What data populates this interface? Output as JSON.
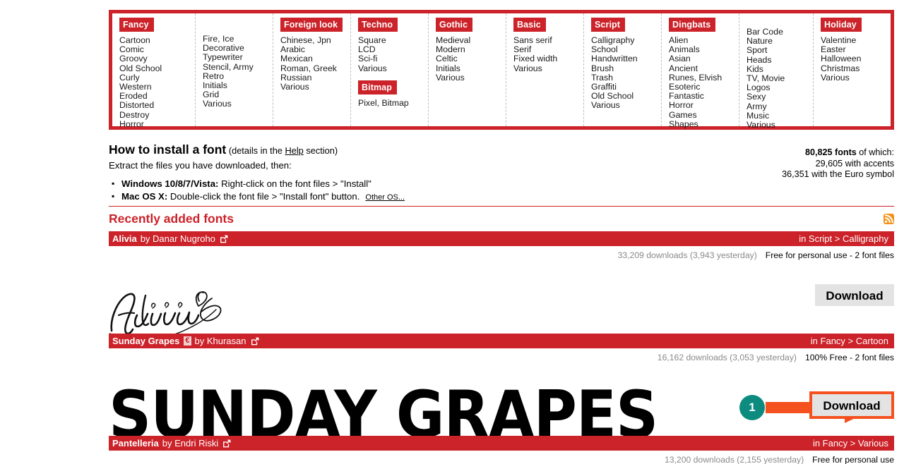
{
  "categories": [
    {
      "heading": "Fancy",
      "items": [
        "Cartoon",
        "Comic",
        "Groovy",
        "Old School",
        "Curly",
        "Western",
        "Eroded",
        "Distorted",
        "Destroy",
        "Horror"
      ]
    },
    {
      "heading": null,
      "items": [
        "Fire, Ice",
        "Decorative",
        "Typewriter",
        "Stencil, Army",
        "Retro",
        "Initials",
        "Grid",
        "Various"
      ]
    },
    {
      "heading": "Foreign look",
      "items": [
        "Chinese, Jpn",
        "Arabic",
        "Mexican",
        "Roman, Greek",
        "Russian",
        "Various"
      ]
    },
    {
      "heading": "Techno",
      "items": [
        "Square",
        "LCD",
        "Sci-fi",
        "Various"
      ],
      "heading2": "Bitmap",
      "items2": [
        "Pixel, Bitmap"
      ]
    },
    {
      "heading": "Gothic",
      "items": [
        "Medieval",
        "Modern",
        "Celtic",
        "Initials",
        "Various"
      ]
    },
    {
      "heading": "Basic",
      "items": [
        "Sans serif",
        "Serif",
        "Fixed width",
        "Various"
      ]
    },
    {
      "heading": "Script",
      "items": [
        "Calligraphy",
        "School",
        "Handwritten",
        "Brush",
        "Trash",
        "Graffiti",
        "Old School",
        "Various"
      ]
    },
    {
      "heading": "Dingbats",
      "items": [
        "Alien",
        "Animals",
        "Asian",
        "Ancient",
        "Runes, Elvish",
        "Esoteric",
        "Fantastic",
        "Horror",
        "Games",
        "Shapes"
      ]
    },
    {
      "heading": null,
      "items": [
        "Bar Code",
        "Nature",
        "Sport",
        "Heads",
        "Kids",
        "TV, Movie",
        "Logos",
        "Sexy",
        "Army",
        "Music",
        "Various"
      ]
    },
    {
      "heading": "Holiday",
      "items": [
        "Valentine",
        "Easter",
        "Halloween",
        "Christmas",
        "Various"
      ]
    }
  ],
  "install": {
    "title": "How to install a font",
    "subtitle_pre": "(details in the ",
    "subtitle_link": "Help",
    "subtitle_post": " section)",
    "extract": "Extract the files you have downloaded, then:",
    "windows_label": "Windows 10/8/7/Vista:",
    "windows_text": " Right-click on the font files > \"Install\"",
    "mac_label": "Mac OS X:",
    "mac_text": " Double-click the font file > \"Install font\" button.",
    "other_os": "Other OS..."
  },
  "counts": {
    "total_bold": "80,825 fonts",
    "total_rest": " of which:",
    "accents": "29,605 with accents",
    "euro": "36,351 with the Euro symbol"
  },
  "recent": {
    "title": "Recently added fonts",
    "rss_icon": "rss-icon"
  },
  "fonts": [
    {
      "name": "Alivia",
      "by": "by Danar Nugroho",
      "badge": null,
      "ext_icon": "external-link-icon",
      "category": "in Script > Calligraphy",
      "downloads": "33,209 downloads (3,943 yesterday)",
      "license": "Free for personal use - 2 font files",
      "download_label": "Download",
      "preview_text": "Alivia"
    },
    {
      "name": "Sunday Grapes",
      "by": "by Khurasan",
      "badge": "€",
      "ext_icon": "external-link-icon",
      "category": "in Fancy > Cartoon",
      "downloads": "16,162 downloads (3,053 yesterday)",
      "license": "100% Free - 2 font files",
      "download_label": "Download",
      "preview_text": "SUNDAY GRAPES"
    },
    {
      "name": "Pantelleria",
      "by": "by Endri Riski",
      "badge": null,
      "ext_icon": "external-link-icon",
      "category": "in Fancy > Various",
      "downloads": "13,200 downloads (2,155 yesterday)",
      "license": "Free for personal use",
      "download_label": "Download",
      "preview_text": ""
    }
  ],
  "annotation": {
    "step_number": "1",
    "circle_color": "#0d8b7f",
    "arrow_color": "#f4511e",
    "highlight_color": "#f4511e"
  },
  "colors": {
    "brand_red": "#cc2229",
    "rss_orange": "#f29218",
    "button_gray": "#e3e3e3"
  }
}
